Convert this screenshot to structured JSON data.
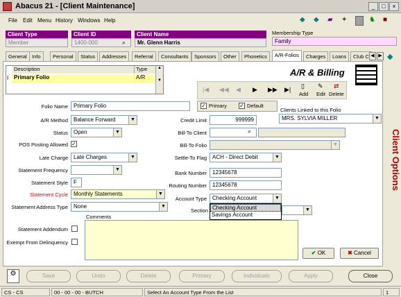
{
  "window": {
    "title": "Abacus 21 - [Client Maintenance]"
  },
  "menu": [
    "File",
    "Edit",
    "Menu",
    "History",
    "Windows",
    "Help"
  ],
  "header": {
    "client_type_label": "Client Type",
    "client_type_value": "Member",
    "client_id_label": "Client ID",
    "client_id_value": "1400-000",
    "client_name_label": "Client Name",
    "client_name_value": "Mr. Glenn Harris",
    "membership_type_label": "Membership Type",
    "membership_type_value": "Family"
  },
  "tabs": [
    "General",
    "Info",
    "Personal",
    "Status",
    "Addresses",
    "Referral",
    "Consultants",
    "Sponsors",
    "Other",
    "Phonetics",
    "A/R-Folios",
    "Charges",
    "Loans",
    "Club C"
  ],
  "active_tab": "A/R-Folios",
  "folio_list": {
    "col_description": "Description",
    "col_type": "Type",
    "rows": [
      {
        "marker": "I",
        "description": "Primary Folio",
        "type": "A/R"
      }
    ]
  },
  "banner": "A/R & Billing",
  "nav_toolbar": {
    "add": "Add",
    "edit": "Edit",
    "delete": "Delete"
  },
  "form": {
    "folio_name_label": "Folio Name",
    "folio_name": "Primary Folio",
    "primary_label": "Primary",
    "default_label": "Default",
    "ar_method_label": "A/R Method",
    "ar_method": "Balance Forward",
    "credit_limit_label": "Credit Limit",
    "credit_limit": "999999",
    "status_label": "Status",
    "status": "Open",
    "bill_to_client_label": "Bill-To Client",
    "pos_label": "POS Posting Allowed",
    "bill_to_folio_label": "Bill-To Folio",
    "late_charge_label": "Late Charge",
    "late_charge": "Late Charges",
    "settle_to_label": "Settle-To Flag",
    "settle_to": "ACH - Direct Debit",
    "stmt_freq_label": "Statement Frequency",
    "bank_number_label": "Bank Number",
    "bank_number": "12345678",
    "stmt_style_label": "Statement Style",
    "stmt_style": "F",
    "routing_label": "Routing Number",
    "routing": "12345678",
    "stmt_cycle_label": "Statement Cycle",
    "stmt_cycle": "Monthly Statements",
    "account_type_label": "Account Type",
    "account_type": "Checking Account",
    "account_type_options": [
      "Checking Account",
      "Savings Account"
    ],
    "stmt_addr_label": "Statement Address Type",
    "stmt_addr": "None",
    "section_label": "Section",
    "comments_label": "Comments",
    "addendum_label": "Statement Addendum",
    "exempt_label": "Exempt From Delinquency",
    "linked_label": "Clients Linked to this Folio",
    "linked_value": "MRS. SYLVIA MILLER",
    "ok": "OK",
    "cancel": "Cancel"
  },
  "side_label": "Client Options",
  "bottom_buttons": [
    "Save",
    "Undo",
    "Delete",
    "Primary",
    "Individuals",
    "Apply",
    "Close"
  ],
  "status_bar": {
    "user": "CS - CS",
    "session": "00 - 00 - 00 - BUTCH",
    "message": "Select An Account Type From the List",
    "count": "1"
  },
  "colors": {
    "header_purple": "#800080",
    "side_label_red": "#b00000"
  }
}
